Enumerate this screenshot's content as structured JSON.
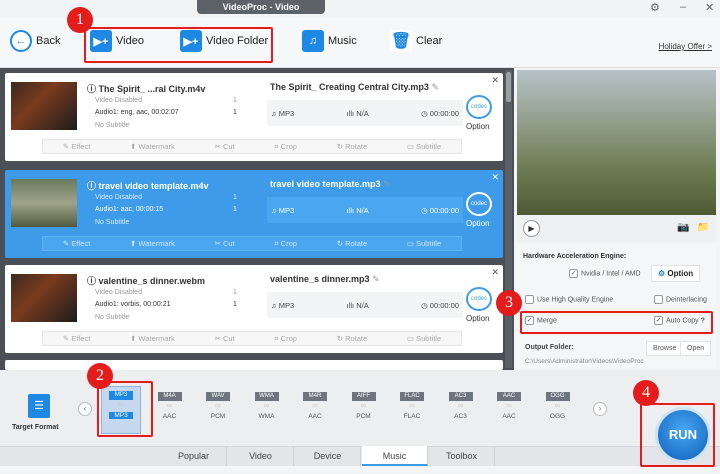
{
  "window": {
    "title": "VideoProc - Video"
  },
  "toolbar": {
    "back": "Back",
    "video": "Video",
    "video_folder": "Video Folder",
    "music": "Music",
    "clear": "Clear",
    "holiday": "Holiday Offer >"
  },
  "rows": [
    {
      "source": "The Spirit_ ...ral City.m4v",
      "video": "Video Disabled",
      "audio": "Audio1: eng, aac, 00:02:07",
      "subtitle": "No Subtitle",
      "output": "The Spirit_ Creating Central City.mp3",
      "format": "MP3",
      "bitrate": "N/A",
      "duration": "00:00:00",
      "selected": false
    },
    {
      "source": "travel video template.m4v",
      "video": "Video Disabled",
      "audio": "Audio1: aac, 00:00:15",
      "subtitle": "No Subtitle",
      "output": "travel video template.mp3",
      "format": "MP3",
      "bitrate": "N/A",
      "duration": "00:00:00",
      "selected": true
    },
    {
      "source": "valentine_s dinner.webm",
      "video": "Video Disabled",
      "audio": "Audio1: vorbis, 00:00:21",
      "subtitle": "No Subtitle",
      "output": "valentine_s dinner.mp3",
      "format": "MP3",
      "bitrate": "N/A",
      "duration": "00:00:00",
      "selected": false
    }
  ],
  "row_common": {
    "option": "Option",
    "codec": "codec",
    "track_count": "1",
    "tools": [
      "Effect",
      "Watermark",
      "Cut",
      "Crop",
      "Rotate",
      "Subtitle"
    ]
  },
  "settings": {
    "hw_title": "Hardware Acceleration Engine:",
    "hw_check": "Nvidia / Intel / AMD",
    "option": "Option",
    "high_quality": "Use High Quality Engine",
    "deinterlacing": "Deinterlacing",
    "merge": "Merge",
    "auto_copy": "Auto Copy",
    "help": "?",
    "output_folder": "Output Folder:",
    "browse": "Browse",
    "open": "Open",
    "path": "C:\\Users\\Administrator\\Videos\\VideoProc"
  },
  "target_format": "Target Format",
  "formats": [
    {
      "top": "MP3",
      "bottom": "MP3",
      "selected": true
    },
    {
      "top": "M4A",
      "bottom": "AAC"
    },
    {
      "top": "WAV",
      "bottom": "PCM"
    },
    {
      "top": "WMA",
      "bottom": "WMA"
    },
    {
      "top": "M4R",
      "bottom": "AAC"
    },
    {
      "top": "AIFF",
      "bottom": "PCM"
    },
    {
      "top": "FLAC",
      "bottom": "FLAC"
    },
    {
      "top": "AC3",
      "bottom": "AC3"
    },
    {
      "top": "AAC",
      "bottom": "AAC"
    },
    {
      "top": "OGG",
      "bottom": "OGG"
    }
  ],
  "tabs": [
    "Popular",
    "Video",
    "Device",
    "Music",
    "Toolbox"
  ],
  "active_tab": "Music",
  "run": "RUN",
  "annotations": [
    "1",
    "2",
    "3",
    "4"
  ],
  "colors": {
    "accent": "#1e88e5",
    "selected_row": "#3d9be9",
    "annotation": "#e51c1c"
  }
}
